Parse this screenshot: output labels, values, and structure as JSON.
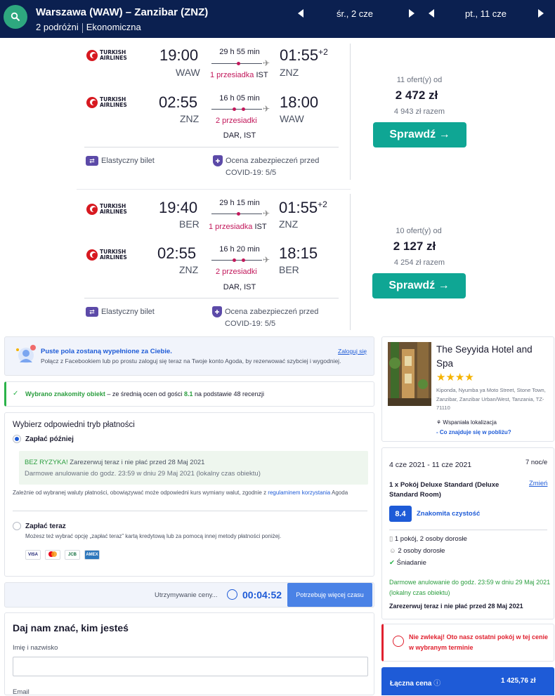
{
  "header": {
    "route": "Warszawa (WAW) – Zanzibar (ZNZ)",
    "travelers": "2 podróżni",
    "cabin": "Ekonomiczna",
    "date_out": "śr., 2 cze",
    "date_back": "pt., 11 cze"
  },
  "flights": [
    {
      "out": {
        "airline": "TURKISH AIRLINES",
        "dep_time": "19:00",
        "dep_code": "WAW",
        "duration": "29 h 55 min",
        "stops": "1 przesiadka",
        "stop_codes": "IST",
        "arr_time": "01:55",
        "arr_offset": "+2",
        "arr_code": "ZNZ"
      },
      "ret": {
        "airline": "TURKISH AIRLINES",
        "dep_time": "02:55",
        "dep_code": "ZNZ",
        "duration": "16 h 05 min",
        "stops": "2 przesiadki",
        "stop_codes": "DAR, IST",
        "arr_time": "18:00",
        "arr_code": "WAW"
      },
      "offers": "11 ofert(y) od",
      "price": "2 472 zł",
      "total": "4 943 zł razem",
      "button": "Sprawdź →",
      "flex": "Elastyczny bilet",
      "covid": "Ocena zabezpieczeń przed COVID-19: 5/5"
    },
    {
      "out": {
        "airline": "TURKISH AIRLINES",
        "dep_time": "19:40",
        "dep_code": "BER",
        "duration": "29 h 15 min",
        "stops": "1 przesiadka",
        "stop_codes": "IST",
        "arr_time": "01:55",
        "arr_offset": "+2",
        "arr_code": "ZNZ"
      },
      "ret": {
        "airline": "TURKISH AIRLINES",
        "dep_time": "02:55",
        "dep_code": "ZNZ",
        "duration": "16 h 20 min",
        "stops": "2 przesiadki",
        "stop_codes": "DAR, IST",
        "arr_time": "18:15",
        "arr_code": "BER"
      },
      "offers": "10 ofert(y) od",
      "price": "2 127 zł",
      "total": "4 254 zł razem",
      "button": "Sprawdź →",
      "flex": "Elastyczny bilet",
      "covid": "Ocena zabezpieczeń przed COVID-19: 5/5"
    }
  ],
  "login_banner": {
    "title": "Puste pola zostaną wypełnione za Ciebie.",
    "text": "Połącz z Facebookiem lub po prostu zaloguj się teraz na Twoje konto Agoda, by rezerwować szybciej i wygodniej.",
    "link": "Zaloguj się"
  },
  "known_property": {
    "bold": "Wybrano znakomity obiekt",
    "text_a": " – ze średnią ocen od gości ",
    "rating": "8.1",
    "text_b": " na podstawie 48 recenzji"
  },
  "payment": {
    "title": "Wybierz odpowiedni tryb płatności",
    "later_label": "Zapłać później",
    "norisk": "BEZ RYZYKA!",
    "norisk_text": " Zarezerwuj teraz i nie płać przed 28 Maj 2021",
    "free_cancel": "Darmowe anulowanie do godz. 23:59 w dniu 29 Maj 2021 (lokalny czas obiektu)",
    "currency_note": "Zależnie od wybranej waluty płatności, obowiązywać może odpowiedni kurs wymiany walut, zgodnie z ",
    "currency_link": "regulaminem korzystania",
    "currency_tail": " Agoda",
    "now_label": "Zapłać teraz",
    "now_note": "Możesz też wybrać opcję „zapłać teraz” kartą kredytową lub za pomocą innej metody płatności poniżej.",
    "cards": [
      "VISA",
      "MC",
      "JCB",
      "AMEX"
    ]
  },
  "hold": {
    "text": "Utrzymywanie ceny...",
    "timer": "00:04:52",
    "button": "Potrzebuję więcej czasu"
  },
  "form": {
    "title": "Daj nam znać, kim jesteś",
    "name_label": "Imię i nazwisko",
    "email_label": "Email"
  },
  "hotel": {
    "name": "The Seyyida Hotel and Spa",
    "stars": "★★★★",
    "address": "Kiponda, Nyumba ya Moto Street, Stone Town, Zanzibar, Zanzibar Urban/West, Tanzania, TZ-71110",
    "location": "Wspaniała lokalizacja",
    "nearby": "- Co znajduje się w pobliżu?"
  },
  "stay": {
    "dates": "4 cze 2021 - 11 cze 2021",
    "nights": "7 noc/e",
    "room": "1 x Pokój Deluxe Standard (Deluxe Standard Room)",
    "change": "Zmień",
    "score": "8.4",
    "score_label": "Znakomita czystość",
    "rooms_guests": "1 pokój, 2 osoby dorosłe",
    "guests": "2 osoby dorosłe",
    "breakfast": "Śniadanie",
    "cancel": "Darmowe anulowanie do godz. 23:59 w dniu 29 Maj 2021 (lokalny czas obiektu)",
    "paylater": "Zarezerwuj teraz i nie płać przed 28 Maj 2021"
  },
  "urgency": {
    "text": "Nie zwlekaj! Oto nasz ostatni pokój w tej cenie w wybranym terminie"
  },
  "total": {
    "label": "Łączna cena",
    "value": "1 425,76 zł"
  },
  "colors": {
    "header": "#0b2050",
    "accent": "#0fa694",
    "stop_red": "#c2185b",
    "agoda_blue": "#1e5bd7",
    "purple": "#5c4aa8"
  }
}
